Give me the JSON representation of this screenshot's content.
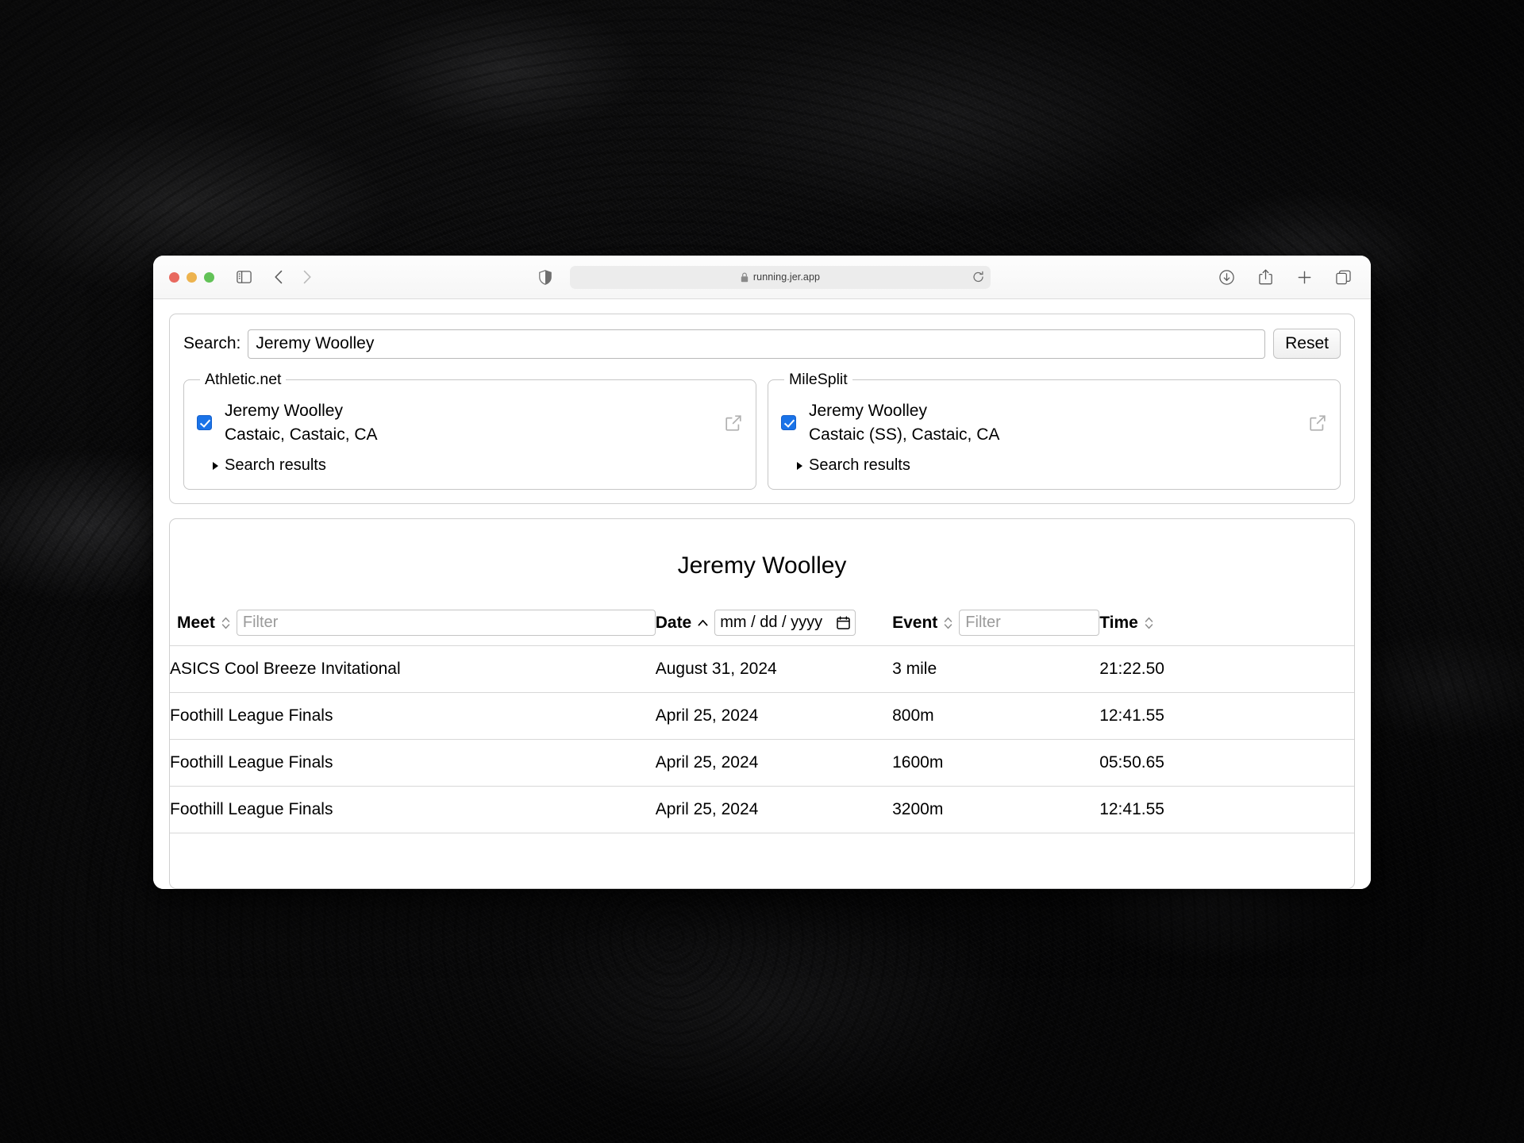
{
  "browser": {
    "traffic_lights": [
      "close",
      "minimize",
      "zoom"
    ],
    "url": "running.jer.app",
    "lock_icon": "lock-icon",
    "sidebar_icon": "sidebar-icon",
    "back_icon": "chevron-left-icon",
    "forward_icon": "chevron-right-icon",
    "shield_icon": "privacy-shield-icon",
    "reload_icon": "reload-icon",
    "downloads_icon": "downloads-icon",
    "share_icon": "share-icon",
    "new_tab_icon": "plus-icon",
    "tab_overview_icon": "tab-overview-icon"
  },
  "search": {
    "label": "Search:",
    "value": "Jeremy Woolley",
    "placeholder": "",
    "reset_label": "Reset"
  },
  "sources": [
    {
      "legend": "Athletic.net",
      "checked": true,
      "athlete_name": "Jeremy Woolley",
      "athlete_location": "Castaic, Castaic, CA",
      "external_link_icon": "external-link-icon",
      "results_toggle_label": "Search results",
      "expanded": false
    },
    {
      "legend": "MileSplit",
      "checked": true,
      "athlete_name": "Jeremy Woolley",
      "athlete_location": "Castaic (SS), Castaic, CA",
      "external_link_icon": "external-link-icon",
      "results_toggle_label": "Search results",
      "expanded": false
    }
  ],
  "results": {
    "title": "Jeremy Woolley",
    "columns": [
      {
        "label": "Meet",
        "sort": "none",
        "filter_type": "text",
        "filter_placeholder": "Filter"
      },
      {
        "label": "Date",
        "sort": "ascending",
        "filter_type": "date",
        "filter_placeholder": "mm / dd / yyyy"
      },
      {
        "label": "Event",
        "sort": "none",
        "filter_type": "text",
        "filter_placeholder": "Filter"
      },
      {
        "label": "Time",
        "sort": "none",
        "filter_type": "none",
        "filter_placeholder": ""
      }
    ],
    "rows": [
      {
        "meet": "ASICS Cool Breeze Invitational",
        "date": "August 31, 2024",
        "event": "3 mile",
        "time": "21:22.50"
      },
      {
        "meet": "Foothill League Finals",
        "date": "April 25, 2024",
        "event": "800m",
        "time": "12:41.55"
      },
      {
        "meet": "Foothill League Finals",
        "date": "April 25, 2024",
        "event": "1600m",
        "time": "05:50.65"
      },
      {
        "meet": "Foothill League Finals",
        "date": "April 25, 2024",
        "event": "3200m",
        "time": "12:41.55"
      }
    ]
  },
  "colors": {
    "checkbox_blue": "#1a73e8",
    "traffic_red": "#e8695f",
    "traffic_yellow": "#edb34e",
    "traffic_green": "#62c257",
    "border": "#cfcfcf",
    "text": "#000000"
  }
}
